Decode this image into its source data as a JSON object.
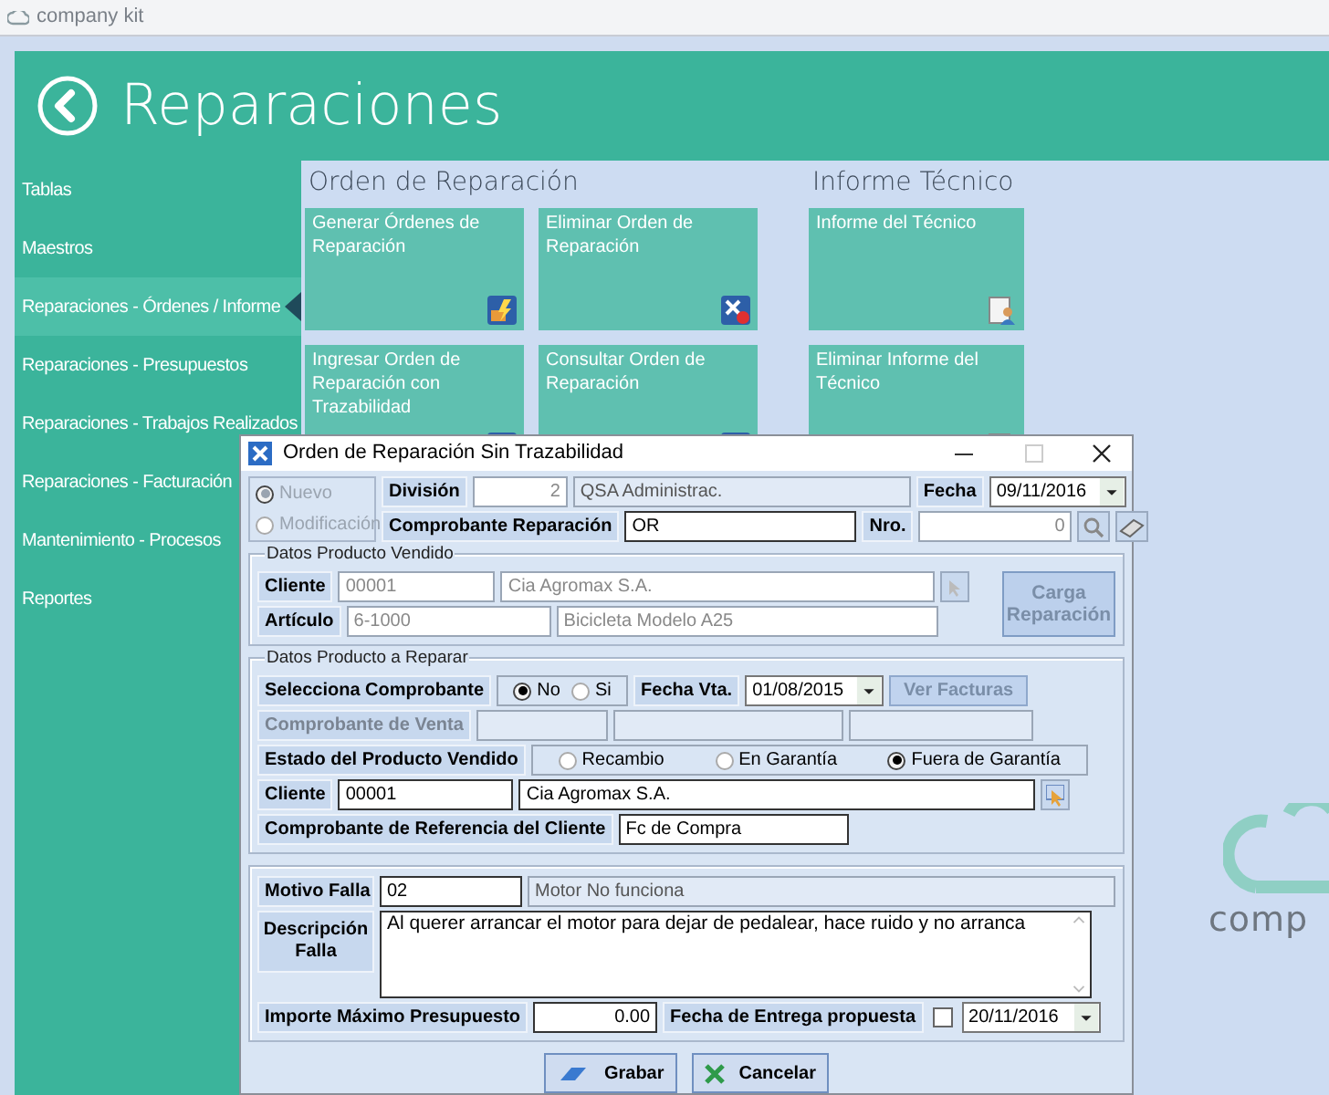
{
  "app_title": "company kit",
  "header": {
    "title": "Reparaciones"
  },
  "sidebar": {
    "items": [
      {
        "label": "Tablas",
        "selected": false
      },
      {
        "label": "Maestros",
        "selected": false
      },
      {
        "label": "Reparaciones - Órdenes / Informe",
        "selected": true
      },
      {
        "label": "Reparaciones - Presupuestos",
        "selected": false
      },
      {
        "label": "Reparaciones - Trabajos Realizados",
        "selected": false
      },
      {
        "label": "Reparaciones - Facturación",
        "selected": false
      },
      {
        "label": "Mantenimiento - Procesos",
        "selected": false
      },
      {
        "label": "Reportes",
        "selected": false
      }
    ]
  },
  "sections": [
    {
      "title": "Orden de Reparación",
      "tiles": [
        {
          "label": "Generar Órdenes de Reparación"
        },
        {
          "label": "Eliminar Orden de Reparación"
        },
        {
          "label": "Ingresar Orden de Reparación con Trazabilidad"
        },
        {
          "label": "Consultar Orden de Reparación"
        }
      ]
    },
    {
      "title": "Informe Técnico",
      "tiles": [
        {
          "label": "Informe del Técnico"
        },
        {
          "label": "Eliminar Informe del Técnico"
        }
      ]
    }
  ],
  "logo": {
    "text": "comp"
  },
  "dialog": {
    "title": "Orden de Reparación Sin Trazabilidad",
    "mode_options": [
      {
        "label": "Nuevo",
        "selected": true
      },
      {
        "label": "Modificación",
        "selected": false
      }
    ],
    "division": {
      "label": "División",
      "code": "2",
      "name": "QSA Administrac."
    },
    "fecha": {
      "label": "Fecha",
      "value": "09/11/2016"
    },
    "comprobante_reparacion": {
      "label": "Comprobante Reparación",
      "value": "OR"
    },
    "nro": {
      "label": "Nro.",
      "value": "0"
    },
    "producto_vendido": {
      "title": "Datos Producto Vendido",
      "cliente": {
        "label": "Cliente",
        "code": "00001",
        "name": "Cia Agromax S.A."
      },
      "articulo": {
        "label": "Artículo",
        "code": "6-1000",
        "name": "Bicicleta Modelo A25"
      },
      "button": "Carga Reparación"
    },
    "producto_reparar": {
      "title": "Datos Producto a Reparar",
      "selecciona": {
        "label": "Selecciona Comprobante",
        "options": [
          {
            "label": "No",
            "selected": true
          },
          {
            "label": "Si",
            "selected": false
          }
        ]
      },
      "fecha_vta": {
        "label": "Fecha Vta.",
        "value": "01/08/2015"
      },
      "ver_button": "Ver Facturas",
      "comprobante_venta": {
        "label": "Comprobante de Venta"
      },
      "estado": {
        "label": "Estado del Producto Vendido",
        "options": [
          {
            "label": "Recambio",
            "selected": false
          },
          {
            "label": "En Garantía",
            "selected": false
          },
          {
            "label": "Fuera de Garantía",
            "selected": true
          }
        ]
      },
      "cliente": {
        "label": "Cliente",
        "code": "00001",
        "name": "Cia Agromax S.A."
      },
      "referencia": {
        "label": "Comprobante de Referencia del Cliente",
        "value": "Fc de Compra"
      }
    },
    "falla": {
      "motivo": {
        "label": "Motivo Falla",
        "code": "02",
        "name": "Motor No funciona"
      },
      "descripcion": {
        "label": "Descripción Falla",
        "value": "Al querer arrancar el motor para dejar de pedalear, hace ruido y no arranca"
      },
      "importe": {
        "label": "Importe Máximo Presupuesto",
        "value": "0.00"
      },
      "entrega": {
        "label": "Fecha de Entrega propuesta",
        "checked": false,
        "value": "20/11/2016"
      }
    },
    "buttons": [
      {
        "label": "Grabar",
        "kind": "save"
      },
      {
        "label": "Cancelar",
        "kind": "cancel"
      }
    ]
  }
}
